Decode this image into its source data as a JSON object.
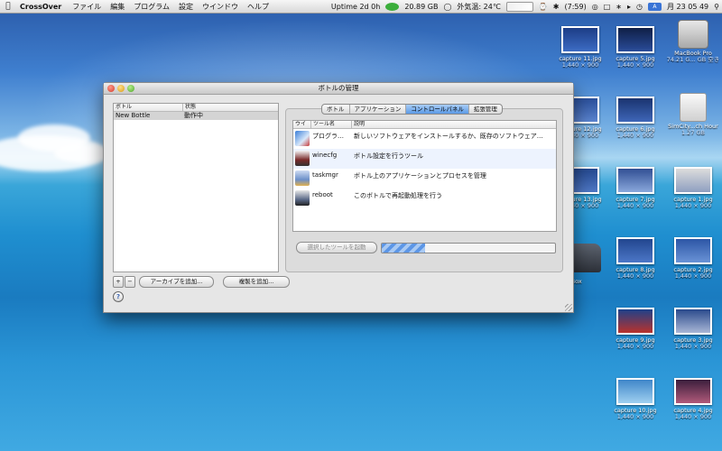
{
  "menubar": {
    "app_name": "CrossOver",
    "items": [
      "ファイル",
      "編集",
      "プログラム",
      "設定",
      "ウインドウ",
      "ヘルプ"
    ],
    "uptime": "Uptime 2d 0h",
    "disk": "20.89 GB",
    "weather": "外気温: 24℃",
    "battery": "(7:59)",
    "clock": "月 23 05 49"
  },
  "desktop": {
    "icons": [
      {
        "name": "capture 11.jpg",
        "size": "1,440 × 900",
        "thumb": "#2a4f9a"
      },
      {
        "name": "capture 5.jpg",
        "size": "1,440 × 900",
        "thumb": "#1c2f66"
      },
      {
        "name": "MacBook Pro",
        "size": "74.21 G... GB 空き",
        "thumb": ""
      },
      {
        "name": "capture 12.jpg",
        "size": "1,440 × 900",
        "thumb": "#2d4f9e"
      },
      {
        "name": "capture 6.jpg",
        "size": "1,440 × 900",
        "thumb": "#223e86"
      },
      {
        "name": "SimCity...ch Hour",
        "size": "1.27 GB",
        "thumb": ""
      },
      {
        "name": "capture 13.jpg",
        "size": "1,440 × 900",
        "thumb": "#2b54a8"
      },
      {
        "name": "capture 7.jpg",
        "size": "1,440 × 900",
        "thumb": "#3a5fb2"
      },
      {
        "name": "capture 1.jpg",
        "size": "1,440 × 900",
        "thumb": "#4d6fa9"
      },
      {
        "name": "capture 8.jpg",
        "size": "1,440 × 900",
        "thumb": "#2f58ad"
      },
      {
        "name": "capture 2.jpg",
        "size": "1,440 × 900",
        "thumb": "#3864b6"
      },
      {
        "name": "capture 9.jpg",
        "size": "1,440 × 900",
        "thumb": "#2e56a9"
      },
      {
        "name": "capture 3.jpg",
        "size": "1,440 × 900",
        "thumb": "#3b5e9f"
      },
      {
        "name": "capture 10.jpg",
        "size": "1,440 × 900",
        "thumb": "#4a8fd0"
      },
      {
        "name": "capture 4.jpg",
        "size": "1,440 × 900",
        "thumb": "#5a2f58"
      }
    ],
    "partial_label": "...si Box"
  },
  "window": {
    "title": "ボトルの管理",
    "bottle_list": {
      "col_bottle": "ボトル",
      "col_status": "状態",
      "rows": [
        {
          "name": "New Bottle",
          "status": "動作中"
        }
      ]
    },
    "add_btn": "+",
    "remove_btn": "−",
    "archive_btn": "アーカイブを追加...",
    "duplicate_btn": "複製を追加...",
    "help": "?",
    "tabs": [
      "ボトル",
      "アプリケーション",
      "コントロールパネル",
      "拡張管理"
    ],
    "active_tab": 2,
    "tools": {
      "col_icon": "ウイ",
      "col_name": "ツール名",
      "col_desc": "説明",
      "rows": [
        {
          "name": "プログラ…",
          "desc": "新しいソフトウェアをインストールするか、既存のソフトウェア…",
          "icon": "install"
        },
        {
          "name": "winecfg",
          "desc": "ボトル設定を行うツール",
          "icon": "winecfg"
        },
        {
          "name": "taskmgr",
          "desc": "ボトル上のアプリケーションとプロセスを管理",
          "icon": "taskmgr"
        },
        {
          "name": "reboot",
          "desc": "このボトルで再起動処理を行う",
          "icon": "reboot"
        }
      ]
    },
    "launch_btn": "選択したツールを起動",
    "progress": 0.25
  }
}
